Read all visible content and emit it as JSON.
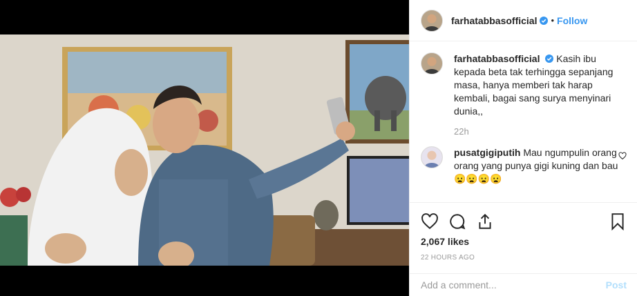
{
  "post": {
    "username": "farhatabbasofficial",
    "follow_label": "Follow",
    "dot": "•",
    "caption": "Kasih ibu kepada beta tak terhingga sepanjang masa, hanya memberi tak harap kembali, bagai sang surya menyinari dunia,,",
    "caption_time": "22h",
    "likes": "2,067 likes",
    "time_ago": "22 HOURS AGO",
    "add_comment_placeholder": "Add a comment...",
    "post_label": "Post"
  },
  "comments": [
    {
      "username": "pusatgigiputih",
      "text": "Mau ngumpulin orang orang yang punya gigi kuning dan bau",
      "emoji": "😦😦😦😦"
    }
  ],
  "icons": {
    "verified": "verified-badge-icon",
    "like": "heart-icon",
    "comment": "comment-icon",
    "share": "share-icon",
    "save": "bookmark-icon"
  },
  "colors": {
    "link": "#3897f0",
    "post_disabled": "#b2dffc",
    "text": "#262626",
    "muted": "#999999"
  }
}
